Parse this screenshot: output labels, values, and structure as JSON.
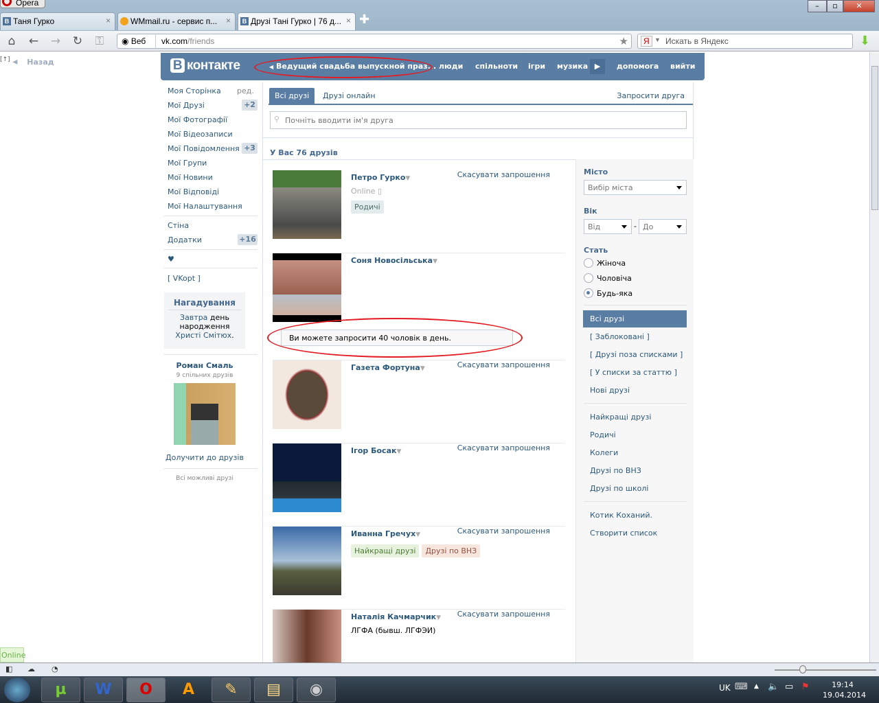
{
  "browser": {
    "menu_label": "Opera",
    "tabs": [
      {
        "title": "Таня Гурко",
        "icon": "В"
      },
      {
        "title": "WMmail.ru - сервис п...",
        "icon": ""
      },
      {
        "title": "Друзі Тані Гурко | 76 д...",
        "icon": "В"
      }
    ],
    "web_label": "Веб",
    "url_host": "vk.com",
    "url_path": "/friends",
    "search_placeholder": "Искать в Яндекс",
    "search_engine_icon": "Я"
  },
  "page": {
    "back": "Назад",
    "back_marker": "[↑]",
    "header": {
      "logo_letter": "В",
      "logo_text": "контакте",
      "status": "Ведущий свадьба выпускной праз...",
      "links": [
        "люди",
        "спільноти",
        "ігри",
        "музика",
        "допомога",
        "вийти"
      ]
    },
    "left_menu": [
      {
        "label": "Моя Сторінка",
        "extra": "ред."
      },
      {
        "label": "Мої Друзі",
        "badge": "+2"
      },
      {
        "label": "Мої Фотографії"
      },
      {
        "label": "Мої Відеозаписи"
      },
      {
        "label": "Мої Повідомлення",
        "badge": "+3"
      },
      {
        "label": "Мої Групи"
      },
      {
        "label": "Мої Новини"
      },
      {
        "label": "Мої Відповіді"
      },
      {
        "label": "Мої Налаштування"
      },
      {
        "label": "Стіна"
      },
      {
        "label": "Додатки",
        "badge": "+16"
      },
      {
        "label": "♥"
      },
      {
        "label": "[ VKopt ]"
      }
    ],
    "reminder": {
      "title": "Нагадування",
      "w1": "Завтра",
      "w2": " день народження ",
      "w3": "Христі Смітюх",
      "w4": "."
    },
    "suggest": {
      "name": "Роман Смаль",
      "mutual": "9 спільних друзів",
      "add": "Долучити до друзів",
      "all": "Всі можливі друзі"
    },
    "tabs": {
      "all": "Всі друзі",
      "online": "Друзі онлайн",
      "invite": "Запросити друга"
    },
    "search_placeholder": "Почніть вводити ім'я друга",
    "count_title": "У Вас 76 друзів",
    "invite_notice": "Ви можете запросити 40 чоловік в день.",
    "friends": [
      {
        "name": "Петро Гурко",
        "status": "Online",
        "tags": [
          "Родичі"
        ],
        "cancel": "Скасувати запрошення"
      },
      {
        "name": "Соня Новосільська"
      },
      {
        "name": "Газета Фортуна",
        "cancel": "Скасувати запрошення"
      },
      {
        "name": "Ігор Босак",
        "cancel": "Скасувати запрошення"
      },
      {
        "name": "Иванна Гречух",
        "tags": [
          "Найкращі друзі",
          "Друзі по ВНЗ"
        ],
        "cancel": "Скасувати запрошення"
      },
      {
        "name": "Наталія Качмарчик",
        "sub": "ЛГФА (бывш. ЛГФЭИ)",
        "cancel": "Скасувати запрошення"
      }
    ],
    "filters": {
      "city_label": "Місто",
      "city_value": "Вибір міста",
      "age_label": "Вік",
      "age_from": "Від",
      "age_to": "До",
      "dash": "-",
      "sex_label": "Стать",
      "sex_options": [
        "Жіноча",
        "Чоловіча",
        "Будь-яка"
      ],
      "sex_selected": "Будь-яка",
      "lists1": [
        "Всі друзі",
        "[ Заблоковані ]",
        "[ Друзі поза списками ]",
        "[ У списки за статтю ]",
        "Нові друзі"
      ],
      "lists2": [
        "Найкращі друзі",
        "Родичі",
        "Колеги",
        "Друзі по ВНЗ",
        "Друзі по школі"
      ],
      "lists3": [
        "Котик Коханий.",
        "Створити список"
      ]
    },
    "online_badge": "Online"
  },
  "taskbar": {
    "lang": "UK",
    "time": "19:14",
    "date": "19.04.2014"
  },
  "colors": {
    "vk_blue": "#597da3",
    "link": "#2b587a",
    "annotation_red": "#e31c24"
  }
}
